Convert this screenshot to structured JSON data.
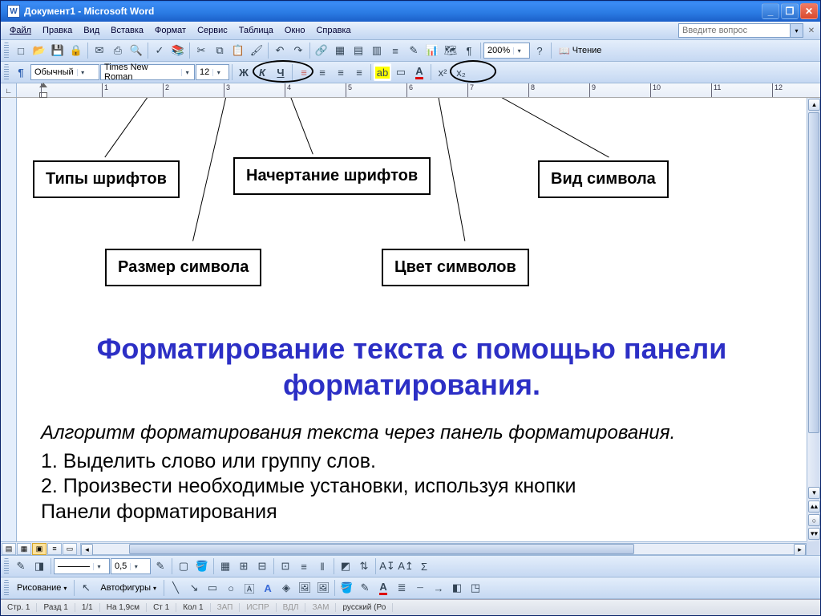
{
  "titlebar": {
    "title": "Документ1 - Microsoft Word"
  },
  "menu": {
    "items": [
      "Файл",
      "Правка",
      "Вид",
      "Вставка",
      "Формат",
      "Сервис",
      "Таблица",
      "Окно",
      "Справка"
    ],
    "ask_placeholder": "Введите вопрос"
  },
  "standard_toolbar": {
    "zoom": "200%",
    "reading": "Чтение"
  },
  "format_toolbar": {
    "style": "Обычный",
    "font": "Times New Roman",
    "size": "12",
    "bold": "Ж",
    "italic": "К",
    "underline": "Ч",
    "superscript": "x²",
    "subscript": "x₂"
  },
  "ruler": {
    "numbers": [
      "",
      "1",
      "2",
      "3",
      "4",
      "5",
      "6",
      "7",
      "8",
      "9",
      "10",
      "11",
      "12"
    ]
  },
  "callouts": {
    "font_types": "Типы шрифтов",
    "size": "Размер символа",
    "style": "Начертание шрифтов",
    "color": "Цвет символов",
    "form": "Вид символа"
  },
  "document": {
    "heading": "Форматирование текста с помощью панели форматирования.",
    "subtitle": "Алгоритм форматирования текста через панель форматирования.",
    "line1": "1. Выделить слово или группу слов.",
    "line2": "2. Произвести необходимые установки, используя кнопки",
    "line3": "Панели форматирования"
  },
  "drawing_toolbar": {
    "line_weight": "0,5",
    "drawing_label": "Рисование",
    "autoshapes": "Автофигуры"
  },
  "statusbar": {
    "page": "Стр. 1",
    "section": "Разд 1",
    "pages": "1/1",
    "at": "На  1,9см",
    "line": "Ст     1",
    "col": "Кол  1",
    "rec": "ЗАП",
    "fix": "ИСПР",
    "ext": "ВДЛ",
    "ovr": "ЗАМ",
    "lang": "русский (Ро"
  },
  "icons": {
    "new": "□",
    "open": "📂",
    "save": "💾",
    "perm": "🔒",
    "mail": "✉",
    "print": "⎙",
    "preview": "🔍",
    "spell": "✓",
    "research": "📚",
    "cut": "✂",
    "copy": "⧉",
    "paste": "📋",
    "fmt_painter": "🖌",
    "undo": "↶",
    "redo": "↷",
    "link": "🔗",
    "tables": "▦",
    "table_insert": "▤",
    "excel": "▥",
    "columns": "≡",
    "drawing": "✎",
    "chart": "📊",
    "map": "🗺",
    "para": "¶",
    "help": "?",
    "book": "📖",
    "align_left": "≡",
    "align_center": "≡",
    "align_right": "≡",
    "justify": "≡",
    "line_spacing": "↕",
    "numbering": "≔",
    "bullets": "•",
    "dec_indent": "⇤",
    "inc_indent": "⇥",
    "borders": "▢",
    "highlight": "ab",
    "font_color": "A",
    "shading": "⬛",
    "read": "📖",
    "style_dd": "¶",
    "arrow": "↖",
    "line": "╲",
    "rect": "▭",
    "oval": "○",
    "textbox": "🄰",
    "wordart": "А",
    "diagram": "◈",
    "clipart": "🖼",
    "picture": "🖼",
    "fill": "🪣",
    "line_color": "✎",
    "font_color2": "A",
    "line_style": "≣",
    "dash": "┈",
    "arrow_style": "→",
    "shadow": "◧",
    "3d": "◳",
    "select": "▭",
    "group": "⧉",
    "ungroup": "⧈",
    "rotate": "⟳",
    "flip": "⇋",
    "align": "⊞",
    "order": "☰",
    "grid": "⊞",
    "sort_a": "A↧",
    "sort_z": "A↥",
    "sum": "Σ"
  }
}
